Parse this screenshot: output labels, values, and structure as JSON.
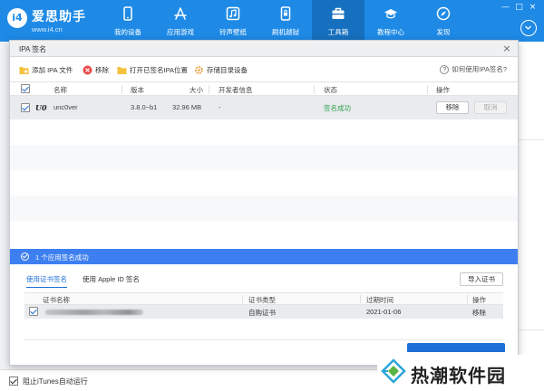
{
  "app": {
    "logo_badge": "i4",
    "name": "爱思助手",
    "url": "www.i4.cn"
  },
  "nav": [
    {
      "label": "我的设备",
      "icon": "phone-icon"
    },
    {
      "label": "应用游戏",
      "icon": "app-store-icon"
    },
    {
      "label": "铃声壁纸",
      "icon": "music-icon"
    },
    {
      "label": "刷机越狱",
      "icon": "lock-phone-icon"
    },
    {
      "label": "工具箱",
      "icon": "toolbox-icon",
      "active": true
    },
    {
      "label": "教程中心",
      "icon": "graduation-cap-icon"
    },
    {
      "label": "发现",
      "icon": "compass-icon"
    }
  ],
  "window_controls": {
    "minimize": "—",
    "maximize": "□",
    "close": "×"
  },
  "dialog": {
    "title": "IPA 签名",
    "close": "×",
    "toolbar": {
      "add_ipa": "添加 IPA 文件",
      "remove": "移除",
      "open_location": "打开已签名IPA位置",
      "storage_dir": "存储目录设备",
      "help": "如何使用IPA签名?"
    },
    "table": {
      "headers": {
        "name": "名称",
        "version": "版本",
        "size": "大小",
        "developer": "开发者信息",
        "status": "状态",
        "action": "操作"
      },
      "rows": [
        {
          "checked": true,
          "icon_text": "U0",
          "name": "unc0ver",
          "version": "3.8.0~b1",
          "size": "32.96 MB",
          "developer": "-",
          "status": "签名成功",
          "remove_btn": "移除",
          "cancel_btn": "取消"
        }
      ]
    },
    "status_bar": {
      "text": "1 个应用签名成功"
    },
    "cert": {
      "tabs": [
        "使用证书签名",
        "使用 Apple ID 签名"
      ],
      "import_btn": "导入证书",
      "headers": {
        "name": "证书名称",
        "type": "证书类型",
        "expiry": "过期时间",
        "action": "操作"
      },
      "rows": [
        {
          "checked": true,
          "type": "自购证书",
          "expiry": "2021-01-06",
          "action": "移除"
        }
      ]
    }
  },
  "footer": {
    "itunes_label": "阻止iTunes自动运行",
    "itunes_checked": true
  },
  "watermark": {
    "text": "热潮软件园"
  },
  "colors": {
    "header_blue": "#1e8ae6",
    "status_blue": "#3d7ff0",
    "success_green": "#2da14b"
  }
}
